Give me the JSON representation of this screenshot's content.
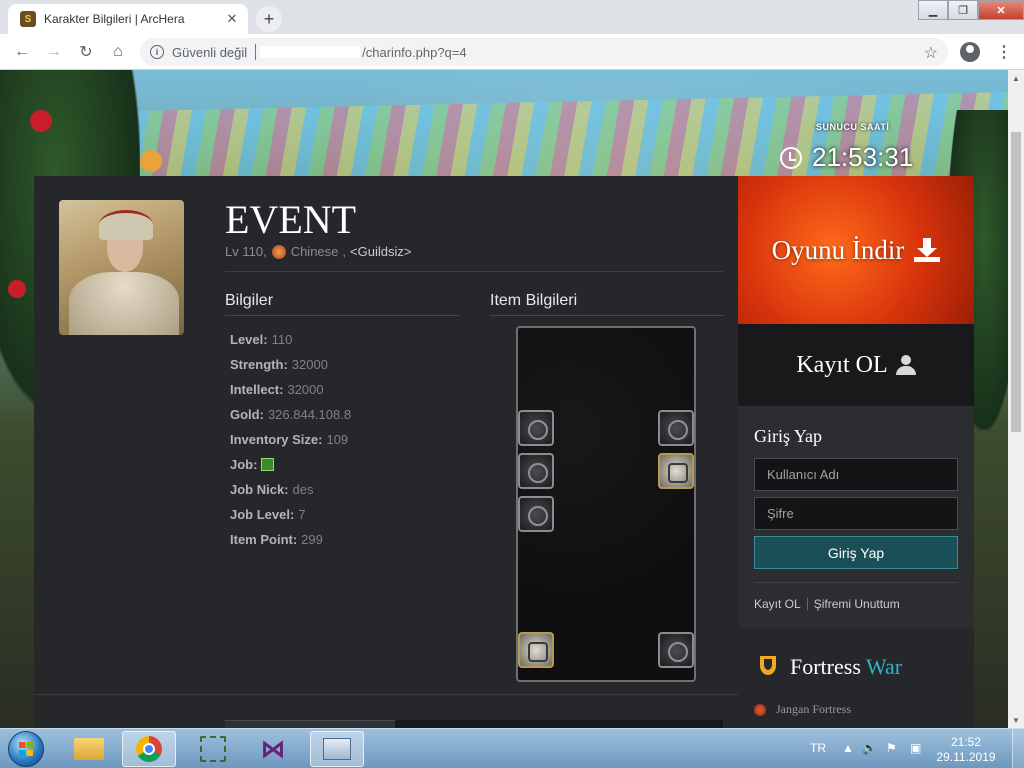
{
  "browser": {
    "tab_title": "Karakter Bilgileri | ArcHera",
    "tab_favicon": "S",
    "security_text": "Güvenli değil",
    "url_path": "/charinfo.php?q=4"
  },
  "header": {
    "server_time_label": "SUNUCU SAATİ",
    "server_time": "21:53:31"
  },
  "character": {
    "name": "EVENT",
    "level_text": "Lv 110,",
    "nation": "Chinese",
    "separator": ",",
    "guild": "<Guildsiz>"
  },
  "info_section": {
    "title": "Bilgiler",
    "stats": [
      {
        "label": "Level:",
        "value": "110"
      },
      {
        "label": "Strength:",
        "value": "32000"
      },
      {
        "label": "Intellect:",
        "value": "32000"
      },
      {
        "label": "Gold:",
        "value": "326.844.108.8"
      },
      {
        "label": "Inventory Size:",
        "value": "109"
      },
      {
        "label": "Job:",
        "value": ""
      },
      {
        "label": "Job Nick:",
        "value": "des"
      },
      {
        "label": "Job Level:",
        "value": "7"
      },
      {
        "label": "Item Point:",
        "value": "299"
      }
    ]
  },
  "item_section": {
    "title": "Item Bilgileri"
  },
  "sidebar": {
    "download_label": "Oyunu İndir",
    "register_label": "Kayıt OL",
    "login": {
      "title": "Giriş Yap",
      "username_placeholder": "Kullanıcı Adı",
      "password_placeholder": "Şifre",
      "submit_label": "Giriş Yap",
      "register_link": "Kayıt OL",
      "forgot_link": "Şifremi Unuttum"
    },
    "fortress": {
      "title_main": "Fortress",
      "title_accent": "War",
      "item": "Jangan Fortress"
    }
  },
  "taskbar": {
    "language": "TR",
    "time": "21:52",
    "date": "29.11.2019"
  },
  "colors": {
    "accent_teal": "#2fb3c4",
    "download_red": "#d8340c",
    "panel_dark": "#25272a"
  }
}
